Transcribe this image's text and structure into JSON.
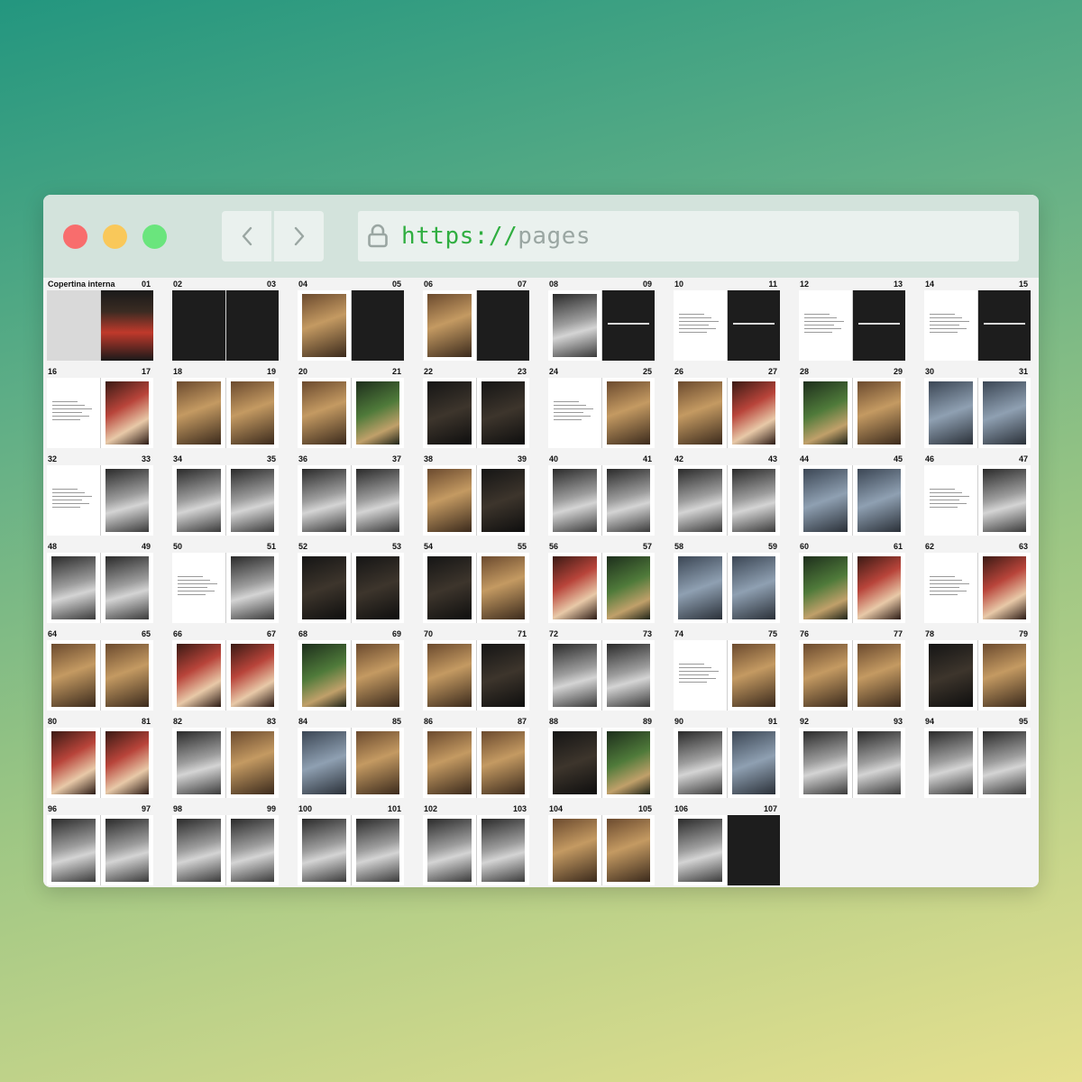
{
  "browser": {
    "url_scheme": "https://",
    "url_rest": "pages",
    "back_icon": "chevron-left-icon",
    "forward_icon": "chevron-right-icon",
    "lock_icon": "lock-icon"
  },
  "colors": {
    "traffic_red": "#f86d6d",
    "traffic_yellow": "#f9c85a",
    "traffic_green": "#6ae57d",
    "url_scheme": "#2fae40",
    "url_rest": "#9aa6a2"
  },
  "spreads": [
    {
      "left": "Copertina interna",
      "right": "01",
      "pages": [
        "blank-gray",
        "cover"
      ]
    },
    {
      "left": "02",
      "right": "03",
      "pages": [
        "dark",
        "dark"
      ]
    },
    {
      "left": "04",
      "right": "05",
      "pages": [
        "photo-warm",
        "dark"
      ]
    },
    {
      "left": "06",
      "right": "07",
      "pages": [
        "photo-warm",
        "dark"
      ]
    },
    {
      "left": "08",
      "right": "09",
      "pages": [
        "photo-bw",
        "dark-title"
      ]
    },
    {
      "left": "10",
      "right": "11",
      "pages": [
        "text",
        "dark-title"
      ]
    },
    {
      "left": "12",
      "right": "13",
      "pages": [
        "text",
        "dark-title"
      ]
    },
    {
      "left": "14",
      "right": "15",
      "pages": [
        "text",
        "dark-title"
      ]
    },
    {
      "left": "16",
      "right": "17",
      "pages": [
        "text",
        "photo-red"
      ]
    },
    {
      "left": "18",
      "right": "19",
      "pages": [
        "photo-warm",
        "photo-warm"
      ]
    },
    {
      "left": "20",
      "right": "21",
      "pages": [
        "photo-warm",
        "photo-green"
      ]
    },
    {
      "left": "22",
      "right": "23",
      "pages": [
        "photo-dark",
        "photo-dark"
      ]
    },
    {
      "left": "24",
      "right": "25",
      "pages": [
        "text",
        "photo-warm"
      ]
    },
    {
      "left": "26",
      "right": "27",
      "pages": [
        "photo-warm",
        "photo-red"
      ]
    },
    {
      "left": "28",
      "right": "29",
      "pages": [
        "photo-green",
        "photo-warm"
      ]
    },
    {
      "left": "30",
      "right": "31",
      "pages": [
        "photo-cool",
        "photo-cool"
      ]
    },
    {
      "left": "32",
      "right": "33",
      "pages": [
        "text",
        "photo-bw"
      ]
    },
    {
      "left": "34",
      "right": "35",
      "pages": [
        "photo-bw",
        "photo-bw"
      ]
    },
    {
      "left": "36",
      "right": "37",
      "pages": [
        "photo-bw",
        "photo-bw"
      ]
    },
    {
      "left": "38",
      "right": "39",
      "pages": [
        "photo-warm",
        "photo-dark"
      ]
    },
    {
      "left": "40",
      "right": "41",
      "pages": [
        "photo-bw",
        "photo-bw"
      ]
    },
    {
      "left": "42",
      "right": "43",
      "pages": [
        "photo-bw",
        "photo-bw"
      ]
    },
    {
      "left": "44",
      "right": "45",
      "pages": [
        "photo-cool",
        "photo-cool"
      ]
    },
    {
      "left": "46",
      "right": "47",
      "pages": [
        "text",
        "photo-bw"
      ]
    },
    {
      "left": "48",
      "right": "49",
      "pages": [
        "photo-bw",
        "photo-bw"
      ]
    },
    {
      "left": "50",
      "right": "51",
      "pages": [
        "text",
        "photo-bw"
      ]
    },
    {
      "left": "52",
      "right": "53",
      "pages": [
        "photo-dark",
        "photo-dark"
      ]
    },
    {
      "left": "54",
      "right": "55",
      "pages": [
        "photo-dark",
        "photo-warm"
      ]
    },
    {
      "left": "56",
      "right": "57",
      "pages": [
        "photo-red",
        "photo-green"
      ]
    },
    {
      "left": "58",
      "right": "59",
      "pages": [
        "photo-cool",
        "photo-cool"
      ]
    },
    {
      "left": "60",
      "right": "61",
      "pages": [
        "photo-green",
        "photo-red"
      ]
    },
    {
      "left": "62",
      "right": "63",
      "pages": [
        "text",
        "photo-red"
      ]
    },
    {
      "left": "64",
      "right": "65",
      "pages": [
        "photo-warm",
        "photo-warm"
      ]
    },
    {
      "left": "66",
      "right": "67",
      "pages": [
        "photo-red",
        "photo-red"
      ]
    },
    {
      "left": "68",
      "right": "69",
      "pages": [
        "photo-green",
        "photo-warm"
      ]
    },
    {
      "left": "70",
      "right": "71",
      "pages": [
        "photo-warm",
        "photo-dark"
      ]
    },
    {
      "left": "72",
      "right": "73",
      "pages": [
        "photo-bw",
        "photo-bw"
      ]
    },
    {
      "left": "74",
      "right": "75",
      "pages": [
        "text",
        "photo-warm"
      ]
    },
    {
      "left": "76",
      "right": "77",
      "pages": [
        "photo-warm",
        "photo-warm"
      ]
    },
    {
      "left": "78",
      "right": "79",
      "pages": [
        "photo-dark",
        "photo-warm"
      ]
    },
    {
      "left": "80",
      "right": "81",
      "pages": [
        "photo-red",
        "photo-red"
      ]
    },
    {
      "left": "82",
      "right": "83",
      "pages": [
        "photo-bw",
        "photo-warm"
      ]
    },
    {
      "left": "84",
      "right": "85",
      "pages": [
        "photo-cool",
        "photo-warm"
      ]
    },
    {
      "left": "86",
      "right": "87",
      "pages": [
        "photo-warm",
        "photo-warm"
      ]
    },
    {
      "left": "88",
      "right": "89",
      "pages": [
        "photo-dark",
        "photo-green"
      ]
    },
    {
      "left": "90",
      "right": "91",
      "pages": [
        "photo-bw",
        "photo-cool"
      ]
    },
    {
      "left": "92",
      "right": "93",
      "pages": [
        "photo-bw",
        "photo-bw"
      ]
    },
    {
      "left": "94",
      "right": "95",
      "pages": [
        "photo-bw",
        "photo-bw"
      ]
    },
    {
      "left": "96",
      "right": "97",
      "pages": [
        "photo-bw",
        "photo-bw"
      ]
    },
    {
      "left": "98",
      "right": "99",
      "pages": [
        "photo-bw",
        "photo-bw"
      ]
    },
    {
      "left": "100",
      "right": "101",
      "pages": [
        "photo-bw",
        "photo-bw"
      ]
    },
    {
      "left": "102",
      "right": "103",
      "pages": [
        "photo-bw",
        "photo-bw"
      ]
    },
    {
      "left": "104",
      "right": "105",
      "pages": [
        "photo-warm",
        "photo-warm"
      ]
    },
    {
      "left": "106",
      "right": "107",
      "pages": [
        "photo-bw",
        "dark"
      ]
    }
  ]
}
